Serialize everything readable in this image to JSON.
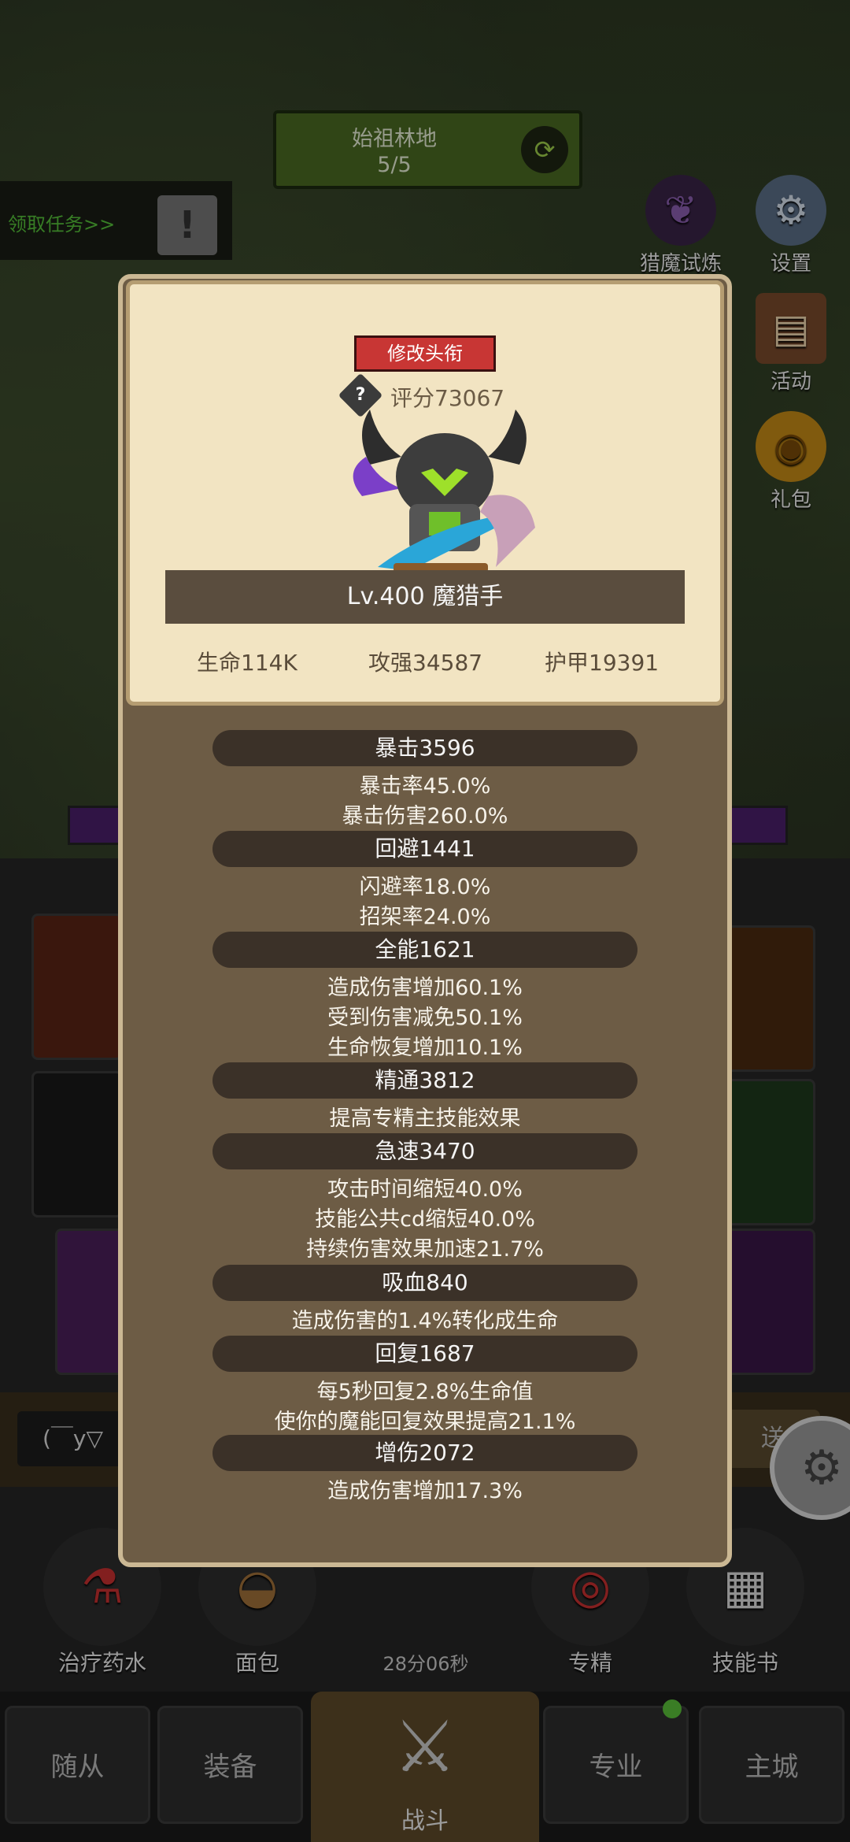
{
  "stage": {
    "name": "始祖林地",
    "progress": "5/5"
  },
  "quest": {
    "label": "领取任务>>"
  },
  "side": {
    "trial": "猎魔试炼",
    "settings": "设置",
    "events": "活动",
    "gift": "礼包"
  },
  "chat": {
    "input_text": "(￣y▽",
    "send_label": "送"
  },
  "items": [
    {
      "label": "治疗药水"
    },
    {
      "label": "面包"
    },
    {
      "label": "专精"
    },
    {
      "label": "技能书"
    }
  ],
  "timer": "28分06秒",
  "nav": {
    "followers": "随从",
    "equipment": "装备",
    "battle": "战斗",
    "profession": "专业",
    "city": "主城"
  },
  "profile": {
    "edit_title_button": "修改头衔",
    "score": "评分73067",
    "level_name": "Lv.400 魔猎手",
    "hp": "生命114K",
    "attack": "攻强34587",
    "armor": "护甲19391"
  },
  "stats": [
    {
      "header": "暴击3596",
      "lines": [
        "暴击率45.0%",
        "暴击伤害260.0%"
      ]
    },
    {
      "header": "回避1441",
      "lines": [
        "闪避率18.0%",
        "招架率24.0%"
      ]
    },
    {
      "header": "全能1621",
      "lines": [
        "造成伤害增加60.1%",
        "受到伤害减免50.1%",
        "生命恢复增加10.1%"
      ]
    },
    {
      "header": "精通3812",
      "lines": [
        "提高专精主技能效果"
      ]
    },
    {
      "header": "急速3470",
      "lines": [
        "攻击时间缩短40.0%",
        "技能公共cd缩短40.0%",
        "持续伤害效果加速21.7%"
      ]
    },
    {
      "header": "吸血840",
      "lines": [
        "造成伤害的1.4%转化成生命"
      ]
    },
    {
      "header": "回复1687",
      "lines": [
        "每5秒回复2.8%生命值",
        "使你的魔能回复效果提高21.1%"
      ]
    },
    {
      "header": "增伤2072",
      "lines": [
        "造成伤害增加17.3%"
      ]
    }
  ],
  "colors": {
    "panel_bg": "#6d5c45",
    "card_bg": "#f2e4c2",
    "accent_red": "#c83634",
    "quest_green": "#55c13a"
  }
}
